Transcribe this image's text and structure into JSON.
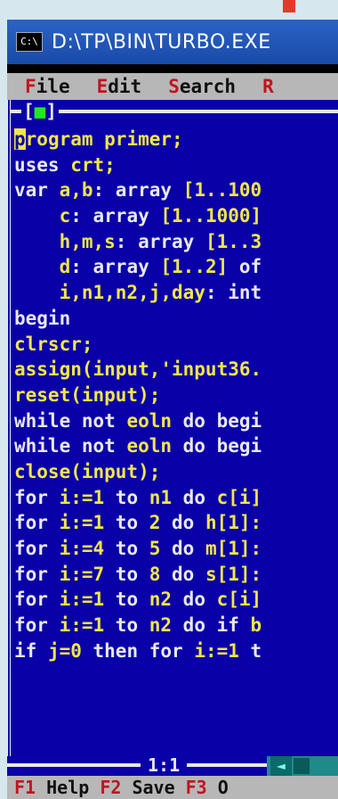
{
  "window": {
    "title": "D:\\TP\\BIN\\TURBO.EXE",
    "icon_label": "C:\\"
  },
  "menu": [
    {
      "hot": "F",
      "rest": "ile"
    },
    {
      "hot": "E",
      "rest": "dit"
    },
    {
      "hot": "S",
      "rest": "earch"
    },
    {
      "hot": "R",
      "rest": ""
    }
  ],
  "editor": {
    "close_box": "[",
    "close_mark": "■",
    "close_end": "]",
    "lines": [
      [
        [
          "cursor",
          "p"
        ],
        [
          "id",
          "rogram primer;"
        ]
      ],
      [
        [
          "kw",
          "uses "
        ],
        [
          "id",
          "crt;"
        ]
      ],
      [
        [
          "kw",
          "var "
        ],
        [
          "id",
          "a,b"
        ],
        [
          "kw",
          ": array "
        ],
        [
          "id",
          "[1..100"
        ]
      ],
      [
        [
          "kw",
          "    "
        ],
        [
          "id",
          "c"
        ],
        [
          "kw",
          ": array "
        ],
        [
          "id",
          "[1..1000]"
        ]
      ],
      [
        [
          "kw",
          "    "
        ],
        [
          "id",
          "h,m,s"
        ],
        [
          "kw",
          ": array "
        ],
        [
          "id",
          "[1..3"
        ]
      ],
      [
        [
          "kw",
          "    "
        ],
        [
          "id",
          "d"
        ],
        [
          "kw",
          ": array "
        ],
        [
          "id",
          "[1..2] "
        ],
        [
          "kw",
          "of"
        ]
      ],
      [
        [
          "kw",
          "    "
        ],
        [
          "id",
          "i,n1,n2,j,day"
        ],
        [
          "kw",
          ": int"
        ]
      ],
      [
        [
          "kw",
          "begin"
        ]
      ],
      [
        [
          "id",
          "clrscr;"
        ]
      ],
      [
        [
          "id",
          "assign(input,'input36."
        ]
      ],
      [
        [
          "id",
          "reset(input);"
        ]
      ],
      [
        [
          "kw",
          "while not "
        ],
        [
          "id",
          "eoln"
        ],
        [
          "kw",
          " do begi"
        ]
      ],
      [
        [
          "kw",
          "while not "
        ],
        [
          "id",
          "eoln"
        ],
        [
          "kw",
          " do begi"
        ]
      ],
      [
        [
          "id",
          "close(input);"
        ]
      ],
      [
        [
          "kw",
          "for "
        ],
        [
          "id",
          "i:=1"
        ],
        [
          "kw",
          " to "
        ],
        [
          "id",
          "n1"
        ],
        [
          "kw",
          " do "
        ],
        [
          "id",
          "c[i]"
        ]
      ],
      [
        [
          "kw",
          "for "
        ],
        [
          "id",
          "i:=1"
        ],
        [
          "kw",
          " to "
        ],
        [
          "id",
          "2"
        ],
        [
          "kw",
          " do "
        ],
        [
          "id",
          "h[1]:"
        ]
      ],
      [
        [
          "kw",
          "for "
        ],
        [
          "id",
          "i:=4"
        ],
        [
          "kw",
          " to "
        ],
        [
          "id",
          "5"
        ],
        [
          "kw",
          " do "
        ],
        [
          "id",
          "m[1]:"
        ]
      ],
      [
        [
          "kw",
          "for "
        ],
        [
          "id",
          "i:=7"
        ],
        [
          "kw",
          " to "
        ],
        [
          "id",
          "8"
        ],
        [
          "kw",
          " do "
        ],
        [
          "id",
          "s[1]:"
        ]
      ],
      [
        [
          "kw",
          "for "
        ],
        [
          "id",
          "i:=1"
        ],
        [
          "kw",
          " to "
        ],
        [
          "id",
          "n2"
        ],
        [
          "kw",
          " do "
        ],
        [
          "id",
          "c[i]"
        ]
      ],
      [
        [
          "kw",
          "for "
        ],
        [
          "id",
          "i:=1"
        ],
        [
          "kw",
          " to "
        ],
        [
          "id",
          "n2"
        ],
        [
          "kw",
          " do if "
        ],
        [
          "id",
          "b"
        ]
      ],
      [
        [
          "kw",
          "if "
        ],
        [
          "id",
          "j=0"
        ],
        [
          "kw",
          " then for "
        ],
        [
          "id",
          "i:=1"
        ],
        [
          "kw",
          " t"
        ]
      ]
    ],
    "cursor_position": "1:1"
  },
  "function_keys": [
    {
      "key": "F1",
      "label": " Help"
    },
    {
      "key": "F2",
      "label": " Save"
    },
    {
      "key": "F3",
      "label": " O"
    }
  ],
  "colors": {
    "editor_bg": "#0a00a8",
    "identifier": "#f0e64a",
    "keyword": "#e8e8e8",
    "menu_bg": "#b7b7b7",
    "hotkey": "#c0141e",
    "title_bar": "#2b63c6"
  }
}
